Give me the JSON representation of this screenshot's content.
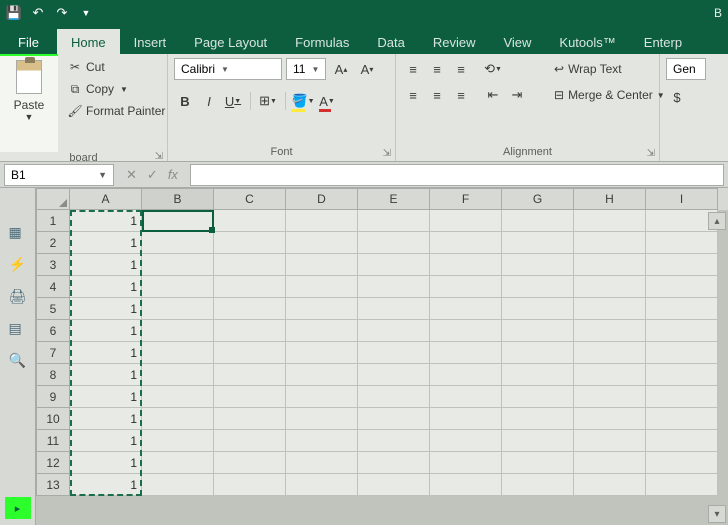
{
  "titlebar": {
    "app": "B"
  },
  "tabs": {
    "file": "File",
    "home": "Home",
    "insert": "Insert",
    "pagelayout": "Page Layout",
    "formulas": "Formulas",
    "data": "Data",
    "review": "Review",
    "view": "View",
    "kutools": "Kutools™",
    "enterprise": "Enterp"
  },
  "clipboard": {
    "paste": "Paste",
    "cut": "Cut",
    "copy": "Copy",
    "formatpainter": "Format Painter",
    "label": "board"
  },
  "font": {
    "name": "Calibri",
    "size": "11",
    "label": "Font",
    "bold": "B",
    "italic": "I",
    "underline": "U"
  },
  "alignment": {
    "wrap": "Wrap Text",
    "merge": "Merge & Center",
    "label": "Alignment"
  },
  "number": {
    "format": "Gen"
  },
  "namebox": "B1",
  "fx": "fx",
  "columns": [
    "A",
    "B",
    "C",
    "D",
    "E",
    "F",
    "G",
    "H",
    "I"
  ],
  "rows": [
    {
      "n": "1",
      "a": "1"
    },
    {
      "n": "2",
      "a": "1"
    },
    {
      "n": "3",
      "a": "1"
    },
    {
      "n": "4",
      "a": "1"
    },
    {
      "n": "5",
      "a": "1"
    },
    {
      "n": "6",
      "a": "1"
    },
    {
      "n": "7",
      "a": "1"
    },
    {
      "n": "8",
      "a": "1"
    },
    {
      "n": "9",
      "a": "1"
    },
    {
      "n": "10",
      "a": "1"
    },
    {
      "n": "11",
      "a": "1"
    },
    {
      "n": "12",
      "a": "1"
    },
    {
      "n": "13",
      "a": "1"
    }
  ]
}
